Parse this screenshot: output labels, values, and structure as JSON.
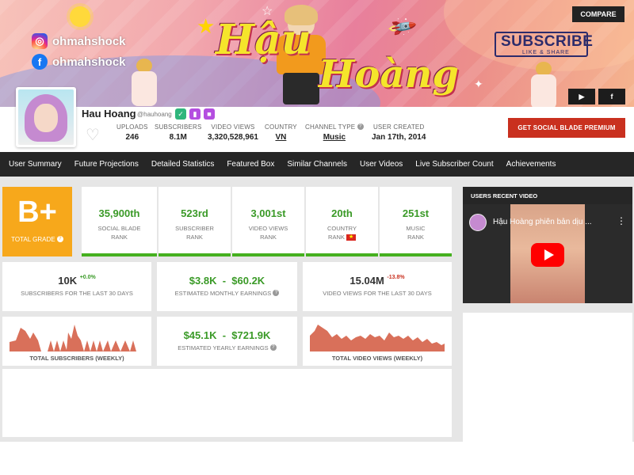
{
  "banner": {
    "instagram_handle": "ohmahshock",
    "facebook_handle": "ohmahshock",
    "title_word1": "Hậu",
    "title_word2": "Hoàng",
    "subscribe_text": "SUBSCRIBE",
    "like_share_text": "LIKE & SHARE",
    "compare_label": "COMPARE",
    "youtube_icon": "youtube-icon",
    "facebook_icon": "facebook-icon"
  },
  "channel": {
    "name": "Hau Hoang",
    "handle": "@hauhoang",
    "stats": [
      {
        "label": "UPLOADS",
        "value": "246"
      },
      {
        "label": "SUBSCRIBERS",
        "value": "8.1M"
      },
      {
        "label": "VIDEO VIEWS",
        "value": "3,320,528,961"
      },
      {
        "label": "COUNTRY",
        "value": "VN"
      },
      {
        "label": "CHANNEL TYPE",
        "value": "Music"
      },
      {
        "label": "USER CREATED",
        "value": "Jan 17th, 2014"
      }
    ],
    "premium_label": "GET SOCIAL BLADE PREMIUM"
  },
  "nav": {
    "items": [
      "User Summary",
      "Future Projections",
      "Detailed Statistics",
      "Featured Box",
      "Similar Channels",
      "User Videos",
      "Live Subscriber Count",
      "Achievements"
    ]
  },
  "grade": {
    "value": "B+",
    "label": "TOTAL GRADE",
    "color": "#f7a81b"
  },
  "ranks": [
    {
      "value": "35,900th",
      "label1": "SOCIAL BLADE",
      "label2": "RANK"
    },
    {
      "value": "523rd",
      "label1": "SUBSCRIBER",
      "label2": "RANK"
    },
    {
      "value": "3,001st",
      "label1": "VIDEO VIEWS",
      "label2": "RANK"
    },
    {
      "value": "20th",
      "label1": "COUNTRY",
      "label2": "RANK"
    },
    {
      "value": "251st",
      "label1": "MUSIC",
      "label2": "RANK"
    }
  ],
  "summary": {
    "subs_30": {
      "value": "10K",
      "delta": "+0.0%",
      "label": "SUBSCRIBERS FOR THE LAST 30 DAYS"
    },
    "monthly": {
      "value": "$3.8K  -  $60.2K",
      "label": "ESTIMATED MONTHLY EARNINGS"
    },
    "views_30": {
      "value": "15.04M",
      "delta": "-13.8%",
      "label": "VIDEO VIEWS FOR THE LAST 30 DAYS"
    },
    "yearly": {
      "value": "$45.1K  -  $721.9K",
      "label": "ESTIMATED YEARLY EARNINGS"
    },
    "subs_chart_label": "TOTAL SUBSCRIBERS (WEEKLY)",
    "views_chart_label": "TOTAL VIDEO VIEWS (WEEKLY)"
  },
  "recent_video": {
    "heading": "USERS RECENT VIDEO",
    "title": "Hậu Hoàng phiên bản dịu ..."
  },
  "colors": {
    "accent_green": "#3a9a27",
    "rank_bar_green": "#45b01f",
    "premium_red": "#c9301f",
    "spark_fill": "#d9705a",
    "nav_bg": "#262626"
  }
}
